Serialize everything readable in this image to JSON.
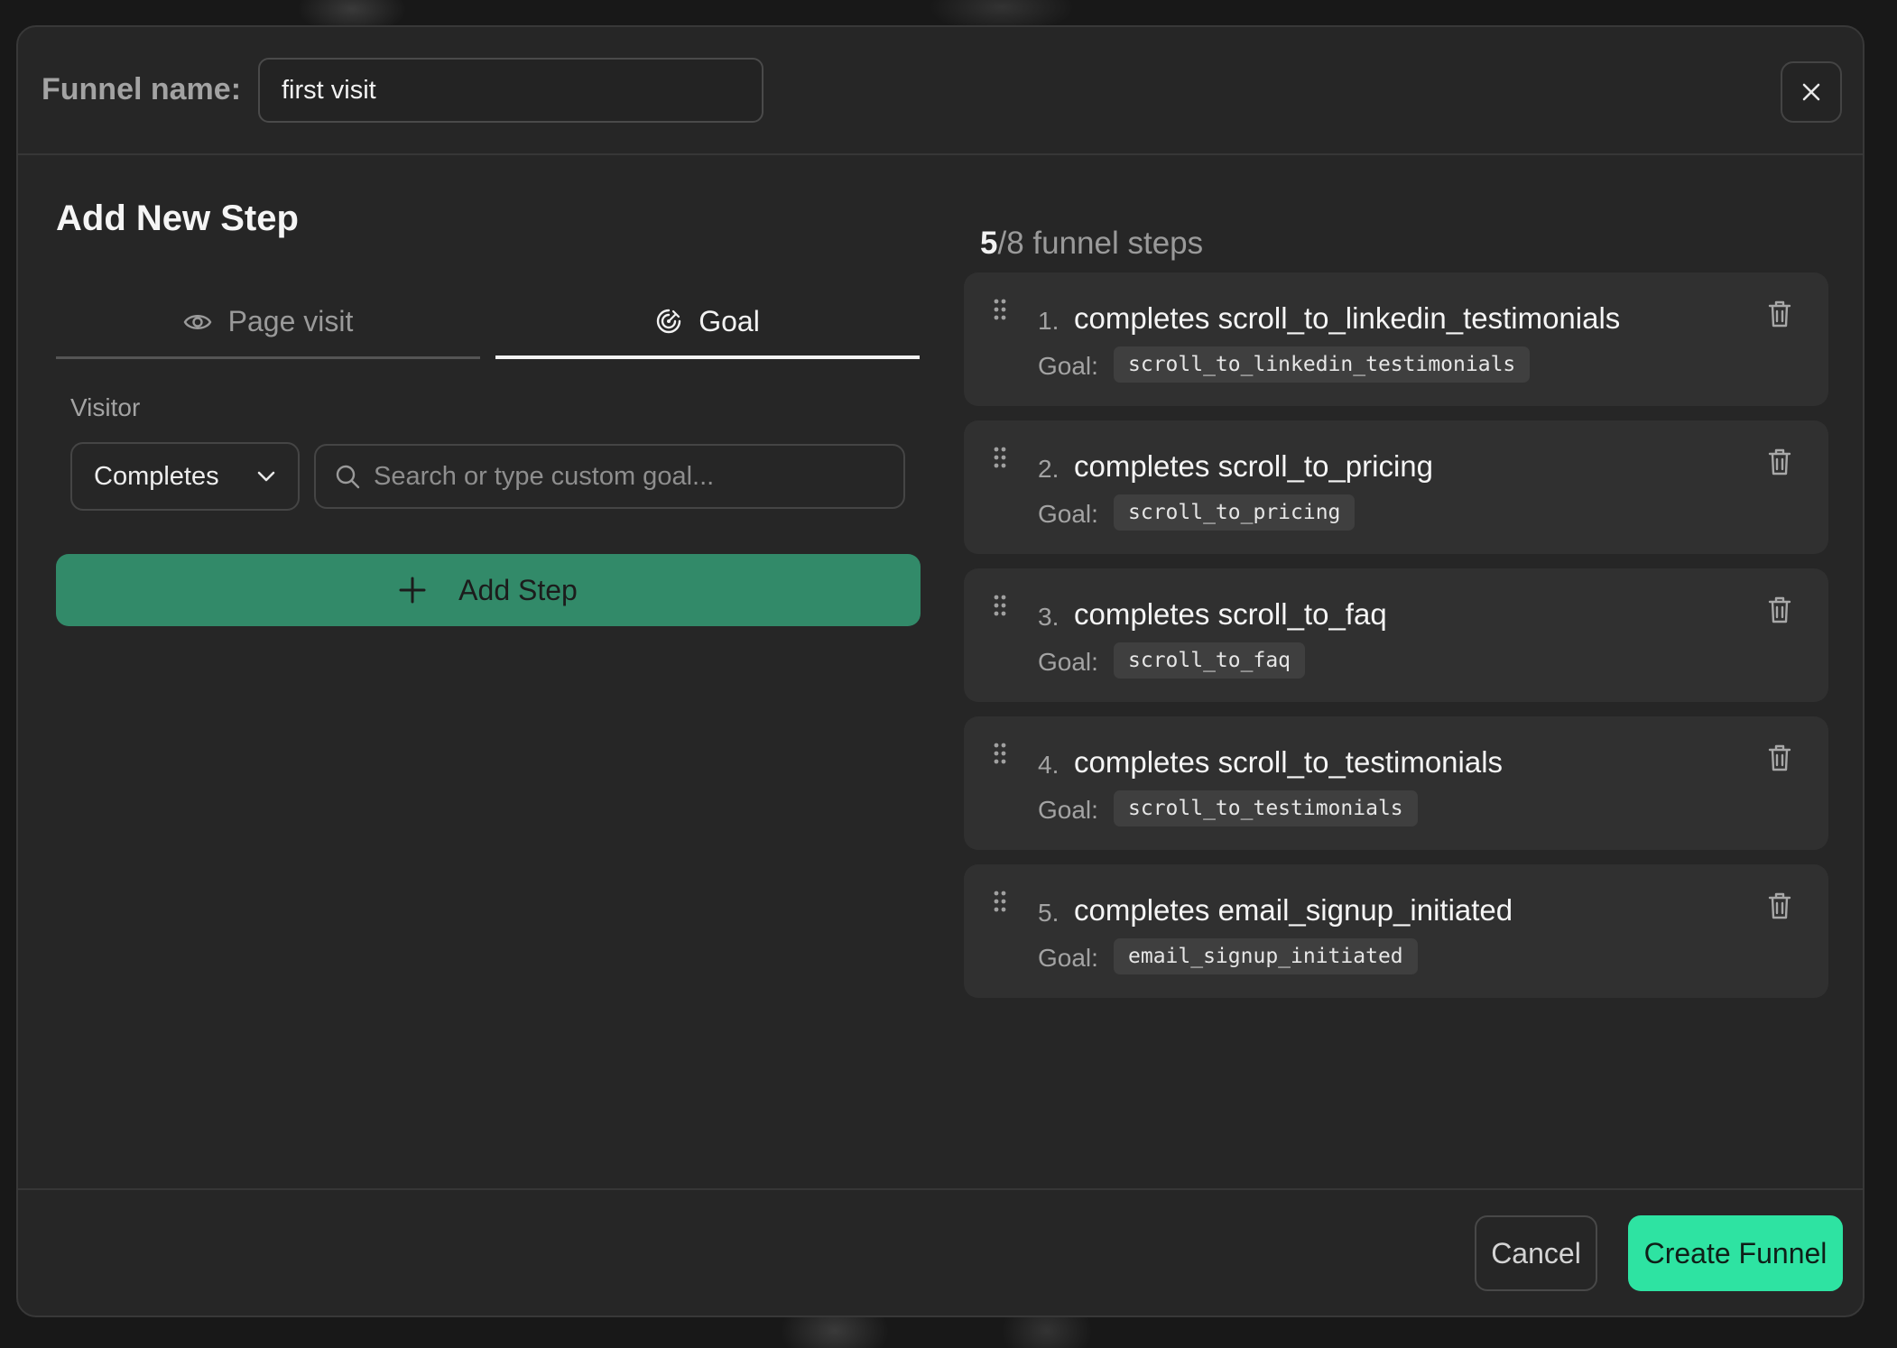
{
  "header": {
    "funnel_label": "Funnel name:",
    "funnel_value": "first visit"
  },
  "add_step_panel": {
    "title": "Add New Step",
    "tabs": [
      {
        "label": "Page visit",
        "icon": "eye-icon",
        "active": false
      },
      {
        "label": "Goal",
        "icon": "target-icon",
        "active": true
      }
    ],
    "visitor_label": "Visitor",
    "select_value": "Completes",
    "search_placeholder": "Search or type custom goal...",
    "add_button_label": "Add Step"
  },
  "steps_panel": {
    "count_current": "5",
    "count_rest": "/8 funnel steps",
    "goal_label": "Goal:",
    "steps": [
      {
        "number": "1.",
        "title": "completes scroll_to_linkedin_testimonials",
        "goal": "scroll_to_linkedin_testimonials"
      },
      {
        "number": "2.",
        "title": "completes scroll_to_pricing",
        "goal": "scroll_to_pricing"
      },
      {
        "number": "3.",
        "title": "completes scroll_to_faq",
        "goal": "scroll_to_faq"
      },
      {
        "number": "4.",
        "title": "completes scroll_to_testimonials",
        "goal": "scroll_to_testimonials"
      },
      {
        "number": "5.",
        "title": "completes email_signup_initiated",
        "goal": "email_signup_initiated"
      }
    ]
  },
  "footer": {
    "cancel_label": "Cancel",
    "create_label": "Create Funnel"
  },
  "colors": {
    "accent_primary": "#2ee3a2",
    "accent_add_step": "#328a69",
    "modal_bg": "#262626",
    "card_bg": "#303030"
  }
}
